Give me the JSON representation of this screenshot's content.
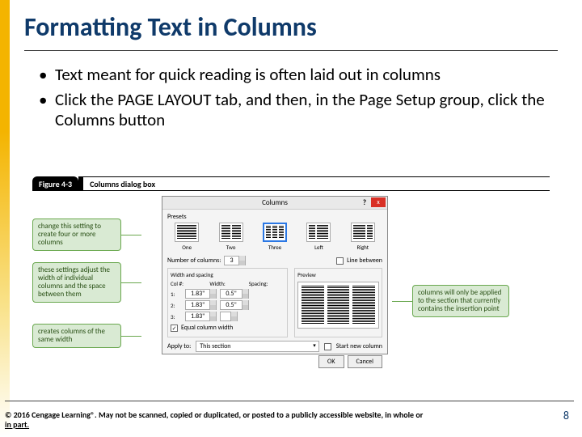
{
  "title": "Formatting Text in Columns",
  "bullets": [
    "Text meant for quick reading is often laid out in columns",
    "Click the PAGE LAYOUT tab, and then, in the Page Setup group, click the Columns button"
  ],
  "figure": {
    "label": "Figure 4-3",
    "caption": "Columns dialog box"
  },
  "callouts": {
    "c1": "change this setting to create four or more columns",
    "c2": "these settings adjust the width of individual columns and the space between them",
    "c3": "creates columns of the same width",
    "c4": "columns will only be applied to the section that currently contains the insertion point"
  },
  "dialog": {
    "title": "Columns",
    "help": "?",
    "close": "x",
    "presets_label": "Presets",
    "presets": {
      "one": "One",
      "two": "Two",
      "three": "Three",
      "left": "Left",
      "right": "Right"
    },
    "num_cols_label": "Number of columns:",
    "num_cols_value": "3",
    "line_between": "Line between",
    "width_spacing_label": "Width and spacing",
    "preview_label": "Preview",
    "col_hdr": "Col #:",
    "width_hdr": "Width:",
    "spacing_hdr": "Spacing:",
    "rows": [
      {
        "idx": "1:",
        "w": "1.83\"",
        "s": "0.5\""
      },
      {
        "idx": "2:",
        "w": "1.83\"",
        "s": "0.5\""
      },
      {
        "idx": "3:",
        "w": "1.83\"",
        "s": ""
      }
    ],
    "equal": "Equal column width",
    "apply_label": "Apply to:",
    "apply_value": "This section",
    "start_new": "Start new column",
    "ok": "OK",
    "cancel": "Cancel"
  },
  "footer": {
    "copyright": "© 2016 Cengage Learning®. May not be scanned, copied or duplicated, or posted to a publicly accessible website, in whole or",
    "sub": "in part."
  },
  "page_number": "8"
}
